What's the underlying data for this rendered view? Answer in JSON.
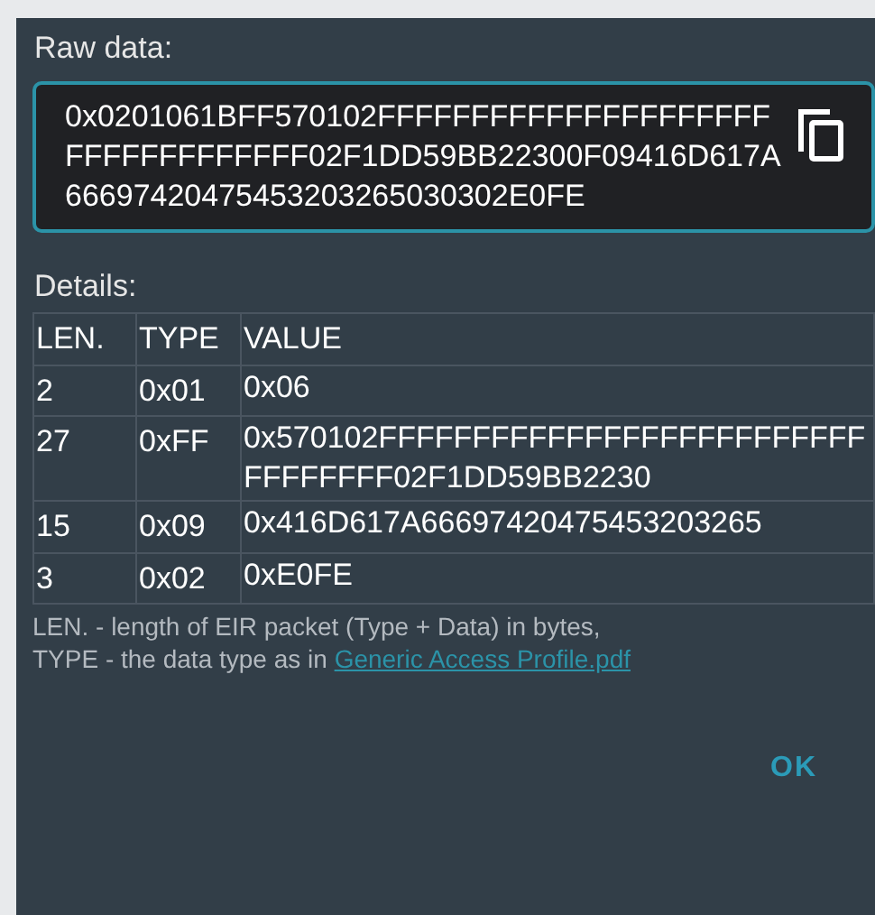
{
  "raw_data": {
    "label": "Raw data:",
    "value": "0x0201061BFF570102FFFFFFFFFFFFFFFFFFFFFFFFFFFFFFFFFF02F1DD59BB22300F09416D617A66697420475453203265030302E0FE"
  },
  "details": {
    "label": "Details:",
    "columns": [
      "LEN.",
      "TYPE",
      "VALUE"
    ],
    "rows": [
      {
        "len": "2",
        "type": "0x01",
        "value": "0x06"
      },
      {
        "len": "27",
        "type": "0xFF",
        "value": "0x570102FFFFFFFFFFFFFFFFFFFFFFFFFFFFFFFFFF02F1DD59BB2230"
      },
      {
        "len": "15",
        "type": "0x09",
        "value": "0x416D617A66697420475453203265"
      },
      {
        "len": "3",
        "type": "0x02",
        "value": "0xE0FE"
      }
    ]
  },
  "note": {
    "line_1": "LEN. - length of EIR packet (Type + Data) in bytes,",
    "line_2": "TYPE - the data type as in ",
    "link": "Generic Access Profile.pdf"
  },
  "buttons": [
    "OK"
  ]
}
